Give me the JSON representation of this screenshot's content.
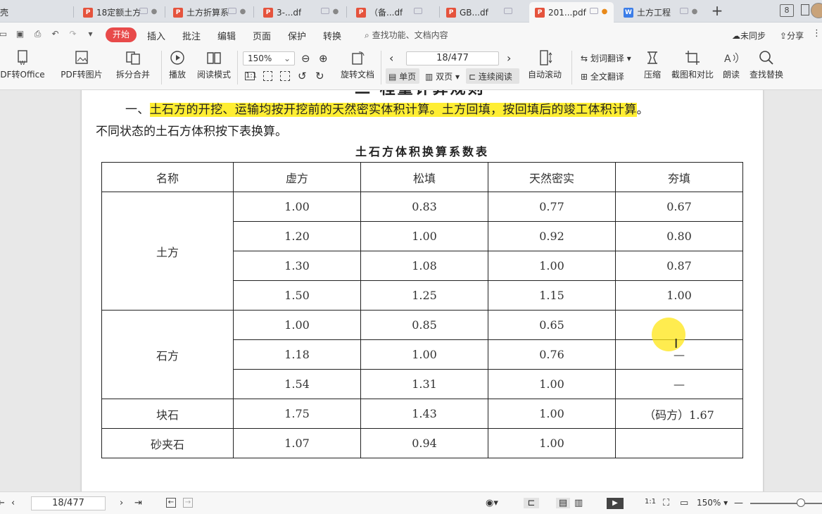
{
  "tabs": [
    {
      "label": "壳",
      "type": "none"
    },
    {
      "label": "18定额土方",
      "type": "pdf"
    },
    {
      "label": "土方折算系",
      "type": "pdf"
    },
    {
      "label": "3-...df",
      "type": "pdf"
    },
    {
      "label": "（备...df",
      "type": "pdf"
    },
    {
      "label": "GB...df",
      "type": "pdf"
    },
    {
      "label": "201...pdf",
      "type": "pdf"
    },
    {
      "label": "土方工程",
      "type": "doc"
    }
  ],
  "window": {
    "tab_count": "8"
  },
  "menu": {
    "start": "开始",
    "insert": "插入",
    "annotate": "批注",
    "edit": "编辑",
    "page": "页面",
    "protect": "保护",
    "convert": "转换",
    "search_placeholder": "查找功能、文档内容",
    "sync": "未同步",
    "share": "分享"
  },
  "toolbar": {
    "pdf_to_office": "DF转Office",
    "pdf_to_image": "PDF转图片",
    "split_merge": "拆分合并",
    "play": "播放",
    "read_mode": "阅读模式",
    "zoom": "150%",
    "page_indicator": "18/477",
    "rotate": "旋转文档",
    "single_page": "单页",
    "double_page": "双页",
    "continuous": "连续阅读",
    "auto_scroll": "自动滚动",
    "word_translate": "划词翻译",
    "full_translate": "全文翻译",
    "compress": "压缩",
    "screenshot_compare": "截图和对比",
    "read_aloud": "朗读",
    "find_replace": "查找替换"
  },
  "document": {
    "heading_partial": "二 程量计算规则",
    "para1_prefix": "一、",
    "para1_highlight": "土石方的开挖、运输均按开挖前的天然密实体积计算。土方回填，按回填后的竣工体积计算",
    "para1_suffix": "。",
    "para2": "不同状态的土石方体积按下表换算。",
    "table_title": "土石方体积换算系数表",
    "table": {
      "headers": [
        "名称",
        "虚方",
        "松填",
        "天然密实",
        "夯填"
      ],
      "groups": [
        {
          "name": "土方",
          "rows": [
            [
              "1.00",
              "0.83",
              "0.77",
              "0.67"
            ],
            [
              "1.20",
              "1.00",
              "0.92",
              "0.80"
            ],
            [
              "1.30",
              "1.08",
              "1.00",
              "0.87"
            ],
            [
              "1.50",
              "1.25",
              "1.15",
              "1.00"
            ]
          ]
        },
        {
          "name": "石方",
          "rows": [
            [
              "1.00",
              "0.85",
              "0.65",
              ""
            ],
            [
              "1.18",
              "1.00",
              "0.76",
              "—"
            ],
            [
              "1.54",
              "1.31",
              "1.00",
              "—"
            ]
          ]
        },
        {
          "name": "块石",
          "rows": [
            [
              "1.75",
              "1.43",
              "1.00",
              "（码方）1.67"
            ]
          ]
        },
        {
          "name": "砂夹石",
          "rows": [
            [
              "1.07",
              "0.94",
              "1.00",
              ""
            ]
          ]
        }
      ]
    }
  },
  "status": {
    "page_indicator": "18/477",
    "zoom": "150%"
  }
}
